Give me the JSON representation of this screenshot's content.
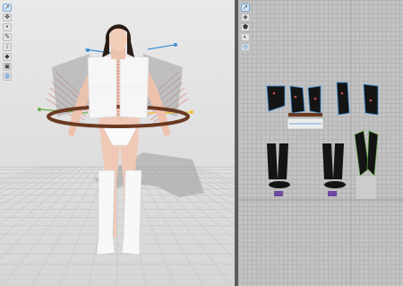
{
  "app": {
    "title": ""
  },
  "toolbar3d": {
    "tools": [
      {
        "icon": "select-mesh-icon",
        "glyph": "➚"
      },
      {
        "icon": "move-icon",
        "glyph": "✥"
      },
      {
        "icon": "pin-icon",
        "glyph": "•"
      },
      {
        "icon": "fold-icon",
        "glyph": "✎"
      },
      {
        "icon": "measure-icon",
        "glyph": "↕"
      },
      {
        "icon": "arrange-point-icon",
        "glyph": "◆"
      },
      {
        "icon": "fabric-icon",
        "glyph": "▣"
      },
      {
        "icon": "simulation-icon",
        "glyph": "◍"
      }
    ]
  },
  "toolbar2d": {
    "tools": [
      {
        "icon": "transform-pattern-icon",
        "glyph": "➚"
      },
      {
        "icon": "edit-point-icon",
        "glyph": "◈"
      },
      {
        "icon": "create-pattern-icon",
        "glyph": "⬟"
      },
      {
        "icon": "sewing-icon",
        "glyph": "◐"
      },
      {
        "icon": "texture-icon",
        "glyph": "◎"
      }
    ]
  },
  "colors": {
    "viewport3d_bg": "#e2e2e2",
    "pattern_bg": "#c3c3c3",
    "splitter": "#5c5c5c",
    "garment": "#f4f4f4",
    "seam_line": "#d05050",
    "arrange_point": "#3d8fd8",
    "belt": "#6b3a22",
    "boots": "#f5f5f5",
    "pattern_black": "#141414",
    "pattern_purple": "#6e4aa0"
  }
}
